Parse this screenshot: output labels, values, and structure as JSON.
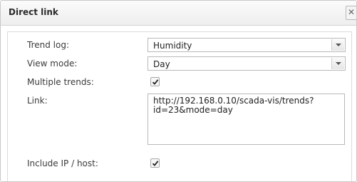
{
  "dialog": {
    "title": "Direct link",
    "close_glyph": "✕"
  },
  "form": {
    "trend_log": {
      "label": "Trend log:",
      "value": "Humidity"
    },
    "view_mode": {
      "label": "View mode:",
      "value": "Day"
    },
    "multiple_trends": {
      "label": "Multiple trends:",
      "checked": true
    },
    "link": {
      "label": "Link:",
      "line1": "http://192.168.0.10/scada-vis/trends?",
      "line2": "id=23&mode=day"
    },
    "include_ip": {
      "label": "Include IP / host:",
      "checked": true
    }
  },
  "icons": {
    "close": "close-icon",
    "dropdown": "chevron-down-icon",
    "check": "checkmark-icon"
  }
}
